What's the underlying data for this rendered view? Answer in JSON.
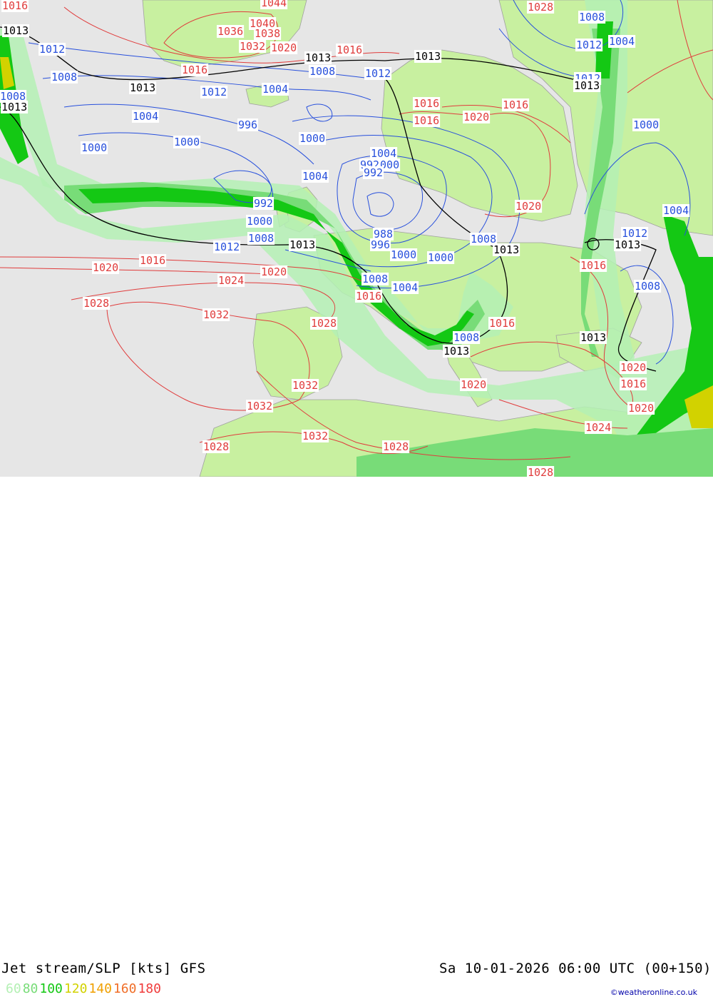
{
  "footer": {
    "title": "Jet stream/SLP [kts] GFS",
    "datetime": "Sa 10-01-2026 06:00 UTC (00+150)",
    "credit": "©weatheronline.co.uk"
  },
  "legend": [
    {
      "label": "60",
      "color": "#b4f0b4"
    },
    {
      "label": "80",
      "color": "#78dc78"
    },
    {
      "label": "100",
      "color": "#14c814"
    },
    {
      "label": "120",
      "color": "#d2d200"
    },
    {
      "label": "140",
      "color": "#f0a000"
    },
    {
      "label": "160",
      "color": "#f06e28"
    },
    {
      "label": "180",
      "color": "#f03c3c"
    }
  ],
  "isobar_labels": {
    "red": [
      "1016",
      "1044",
      "1040",
      "1036",
      "1038",
      "1032",
      "1020",
      "1016",
      "1016",
      "1016",
      "1016",
      "1020",
      "1020",
      "1016",
      "1020",
      "1024",
      "1020",
      "1016",
      "1016",
      "1028",
      "1032",
      "1028",
      "1016",
      "1020",
      "1032",
      "1032",
      "1032",
      "1028",
      "1028",
      "1028",
      "1020",
      "1024",
      "1028",
      "1016",
      "1020",
      "1016"
    ],
    "blue": [
      "1012",
      "1008",
      "1008",
      "1012",
      "1012",
      "1004",
      "1004",
      "996",
      "1000",
      "1000",
      "1000",
      "1004",
      "1000",
      "992",
      "992",
      "1004",
      "1000",
      "988",
      "996",
      "1000",
      "1004",
      "1008",
      "1008",
      "1012",
      "1008",
      "1004",
      "1000",
      "1008",
      "1012",
      "1004",
      "1012",
      "1008",
      "992",
      "1000",
      "1008",
      "1012",
      "1008"
    ],
    "black": [
      "1013",
      "1013",
      "1013",
      "1013",
      "1013",
      "1013",
      "1013",
      "1013",
      "1013",
      "1013",
      "1013"
    ]
  }
}
